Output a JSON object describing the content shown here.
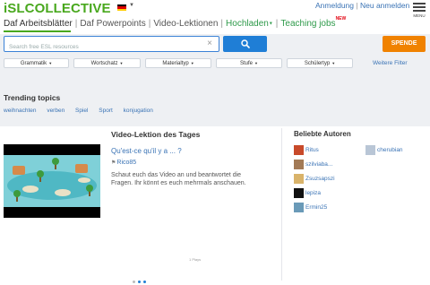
{
  "header": {
    "logo": "iSLCOLLECTIVE",
    "auth_login": "Anmeldung",
    "auth_sep": "|",
    "auth_register": "Neu anmelden",
    "menu_label": "MENU"
  },
  "nav": {
    "items": [
      "Daf Arbeitsblätter",
      "Daf Powerpoints",
      "Video-Lektionen",
      "Hochladen",
      "Teaching jobs"
    ],
    "new_badge": "NEW"
  },
  "search": {
    "placeholder": "Search free ESL resources",
    "value": ""
  },
  "spende_label": "SPENDE",
  "filters": [
    "Grammatik",
    "Wortschatz",
    "Materialtyp",
    "Stufe",
    "Schülertyp"
  ],
  "more_filters": "Weitere Filter",
  "trending": {
    "title": "Trending topics",
    "tags": [
      "weihnachten",
      "verben",
      "Spiel",
      "Sport",
      "konjugation"
    ]
  },
  "video": {
    "section_title": "Video-Lektion des Tages",
    "title": "Qu'est-ce qu'il y a ... ?",
    "author": "Rico85",
    "description": "Schaut euch das Video an und beantwortet die Fragen. Ihr könnt es euch mehrmals anschauen.",
    "plays": "1 Plays"
  },
  "authors": {
    "title": "Beliebte Autoren",
    "left": [
      "Ritus",
      "szilviaba...",
      "Zsuzsapszi",
      "lepiza",
      "Ermin25"
    ],
    "right": [
      "cherubian"
    ]
  },
  "colors": {
    "brand": "#49a81e",
    "link": "#3a73b5",
    "search": "#1f7ed6",
    "donate": "#f08200"
  }
}
